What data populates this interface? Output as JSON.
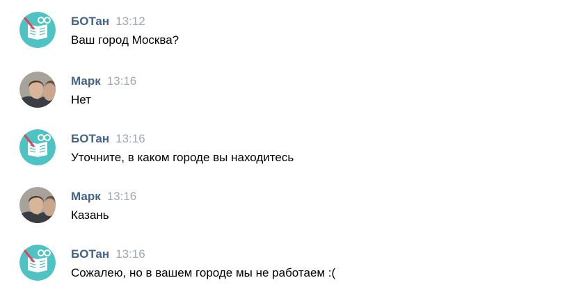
{
  "messages": [
    {
      "author": "БОТан",
      "time": "13:12",
      "text": "Ваш город Москва?",
      "avatar": "book-icon"
    },
    {
      "author": "Марк",
      "time": "13:16",
      "text": "Нет",
      "avatar": "user-photo"
    },
    {
      "author": "БОТан",
      "time": "13:16",
      "text": "Уточните, в каком городе вы находитесь",
      "avatar": "book-icon"
    },
    {
      "author": "Марк",
      "time": "13:16",
      "text": "Казань",
      "avatar": "user-photo"
    },
    {
      "author": "БОТан",
      "time": "13:16",
      "text": "Сожалею, но в вашем городе мы не работаем :(",
      "avatar": "book-icon"
    }
  ],
  "colors": {
    "author": "#42648b",
    "time": "#a0a8b2",
    "bot_avatar_bg": "#4fc3c4"
  }
}
